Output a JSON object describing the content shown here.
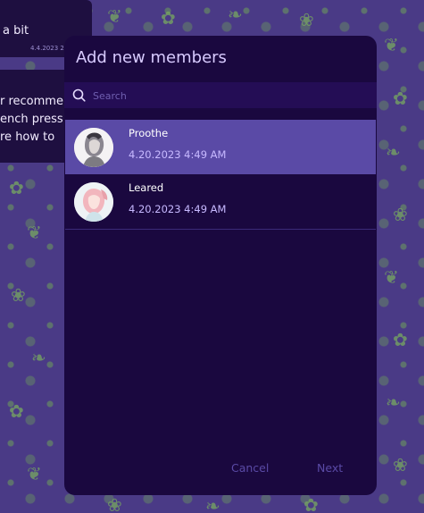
{
  "background_chat": {
    "bubble1_text": "a bit",
    "bubble1_timestamp": "4.4.2023 2",
    "bubble2_lines": [
      "r recommend",
      "ench press.",
      "re how to"
    ]
  },
  "dialog": {
    "title": "Add new members",
    "search": {
      "placeholder": "Search",
      "value": "",
      "icon": "search-icon"
    },
    "members": [
      {
        "name": "Proothe",
        "time": "4.20.2023 4:49 AM",
        "selected": true
      },
      {
        "name": "Leared",
        "time": "4.20.2023 4:49 AM",
        "selected": false
      }
    ],
    "buttons": {
      "cancel": "Cancel",
      "next": "Next"
    }
  },
  "colors": {
    "dialog_bg": "#1a083f",
    "search_bg": "#240d55",
    "selected_row": "#5a4aa6",
    "title": "#d8cbff",
    "timestamp": "#c7b9ff",
    "wallpaper": "#4a3a86",
    "wallpaper_pattern": "#6ea05a"
  }
}
